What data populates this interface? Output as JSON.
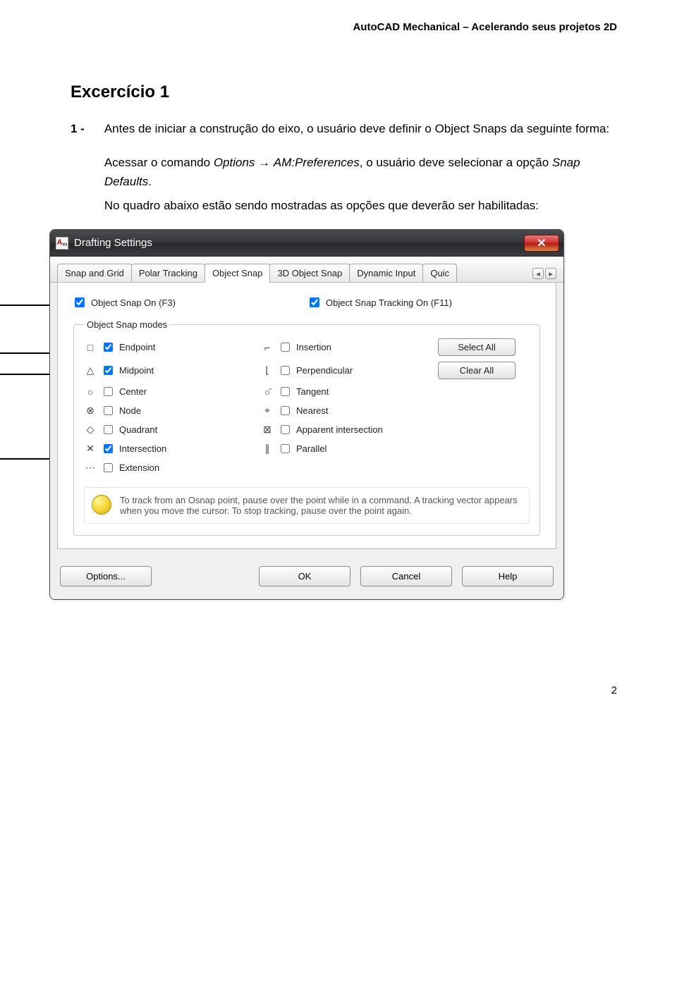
{
  "header": "AutoCAD Mechanical – Acelerando seus projetos 2D",
  "title": "Excercício 1",
  "bullet_num": "1 -",
  "para1": "Antes de iniciar a construção do eixo, o usuário deve definir o Object Snaps da seguinte forma:",
  "para2_a": "Acessar o comando ",
  "para2_opt": "Options",
  "para2_arrow": " → ",
  "para2_pref": "AM:Preferences",
  "para2_b": ", o usuário deve selecionar a opção ",
  "para2_snap": "Snap Defaults",
  "para2_dot": ".",
  "para3": "No quadro abaixo estão sendo mostradas as opções que deverão ser habilitadas:",
  "dlg": {
    "title": "Drafting Settings",
    "close": "✕",
    "tabs": {
      "t1": "Snap and Grid",
      "t2": "Polar Tracking",
      "t3": "Object Snap",
      "t4": "3D Object Snap",
      "t5": "Dynamic Input",
      "t6": "Quic",
      "left": "◂",
      "right": "▸"
    },
    "osnap_on": "Object Snap On (F3)",
    "osnap_track": "Object Snap Tracking On (F11)",
    "legend": "Object Snap modes",
    "modes_left": [
      {
        "sym": "□",
        "label": "Endpoint",
        "checked": true
      },
      {
        "sym": "△",
        "label": "Midpoint",
        "checked": true
      },
      {
        "sym": "○",
        "label": "Center",
        "checked": false
      },
      {
        "sym": "⊗",
        "label": "Node",
        "checked": false
      },
      {
        "sym": "◇",
        "label": "Quadrant",
        "checked": false
      },
      {
        "sym": "✕",
        "label": "Intersection",
        "checked": true
      },
      {
        "sym": "⋯",
        "label": "Extension",
        "checked": false
      }
    ],
    "modes_right": [
      {
        "sym": "⌐",
        "label": "Insertion",
        "checked": false
      },
      {
        "sym": "⌊",
        "label": "Perpendicular",
        "checked": false
      },
      {
        "sym": "○̄",
        "label": "Tangent",
        "checked": false
      },
      {
        "sym": "⌖",
        "label": "Nearest",
        "checked": false
      },
      {
        "sym": "⊠",
        "label": "Apparent intersection",
        "checked": false
      },
      {
        "sym": "∥",
        "label": "Parallel",
        "checked": false
      }
    ],
    "select_all": "Select All",
    "clear_all": "Clear All",
    "hint": "To track from an Osnap point, pause over the point while in a command.  A tracking vector appears when you move the cursor. To stop tracking, pause over the point again.",
    "btn_options": "Options...",
    "btn_ok": "OK",
    "btn_cancel": "Cancel",
    "btn_help": "Help"
  },
  "pagenum": "2"
}
